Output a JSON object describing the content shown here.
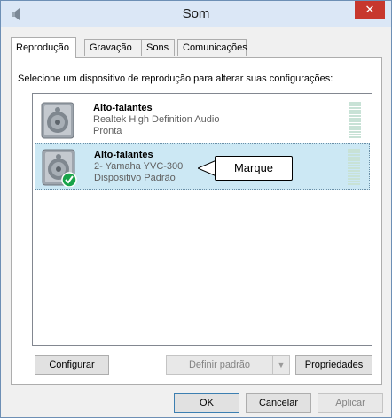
{
  "window": {
    "title": "Som",
    "close_glyph": "✕"
  },
  "tabs": [
    {
      "label": "Reprodução",
      "active": true
    },
    {
      "label": "Gravação"
    },
    {
      "label": "Sons"
    },
    {
      "label": "Comunicações"
    }
  ],
  "instruction": "Selecione um dispositivo de reprodução para alterar suas configurações:",
  "devices": [
    {
      "name": "Alto-falantes",
      "driver": "Realtek High Definition Audio",
      "status": "Pronta",
      "icon": "speaker-icon",
      "selected": false
    },
    {
      "name": "Alto-falantes",
      "driver": "2- Yamaha YVC-300",
      "status": "Dispositivo Padrão",
      "icon": "speaker-icon",
      "default_badge": "check-icon",
      "selected": true
    }
  ],
  "callout": {
    "label": "Marque"
  },
  "buttons": {
    "configure": "Configurar",
    "set_default": "Definir padrão",
    "set_default_arrow": "▼",
    "properties": "Propriedades",
    "ok": "OK",
    "cancel": "Cancelar",
    "apply": "Aplicar"
  },
  "colors": {
    "selection": "#cce8f4",
    "title_bar": "#dbe7f6",
    "close_button": "#c7372d",
    "check_badge": "#1aa34a"
  }
}
